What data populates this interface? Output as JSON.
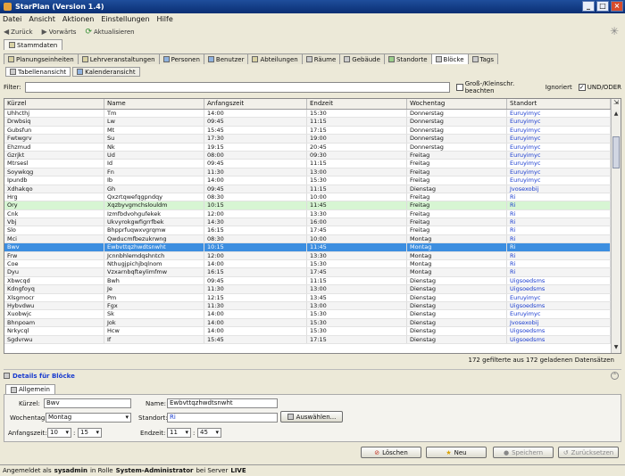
{
  "window": {
    "title": "StarPlan (Version 1.4)"
  },
  "menu": [
    "Datei",
    "Ansicht",
    "Aktionen",
    "Einstellungen",
    "Hilfe"
  ],
  "nav": {
    "back": "Zurück",
    "forward": "Vorwärts",
    "refresh": "Aktualisieren"
  },
  "outer_tab": "Stammdaten",
  "tabs": [
    "Planungseinheiten",
    "Lehrveranstaltungen",
    "Personen",
    "Benutzer",
    "Abteilungen",
    "Räume",
    "Gebäude",
    "Standorte",
    "Blöcke",
    "Tags"
  ],
  "active_tab": "Blöcke",
  "views": [
    "Tabellenansicht",
    "Kalenderansicht"
  ],
  "filter": {
    "label": "Filter:",
    "value": "",
    "case_label": "Groß-/Kleinschr. beachten",
    "ignore_label": "Ignoriert",
    "andor_label": "UND/ODER"
  },
  "columns": [
    "Kürzel",
    "Name",
    "Anfangszeit",
    "Endzeit",
    "Wochentag",
    "Standort"
  ],
  "rows": [
    [
      "Uhhcthj",
      "Tm",
      "14:00",
      "15:30",
      "Donnerstag",
      "Euruyimyc"
    ],
    [
      "Drwbsiq",
      "Lw",
      "09:45",
      "11:15",
      "Donnerstag",
      "Euruyimyc"
    ],
    [
      "Gubsfun",
      "Mt",
      "15:45",
      "17:15",
      "Donnerstag",
      "Euruyimyc"
    ],
    [
      "Fwtwgrv",
      "Su",
      "17:30",
      "19:00",
      "Donnerstag",
      "Euruyimyc"
    ],
    [
      "Ehzmud",
      "Nk",
      "19:15",
      "20:45",
      "Donnerstag",
      "Euruyimyc"
    ],
    [
      "Gzrjkt",
      "Ud",
      "08:00",
      "09:30",
      "Freitag",
      "Euruyimyc"
    ],
    [
      "Mtrsesl",
      "Id",
      "09:45",
      "11:15",
      "Freitag",
      "Euruyimyc"
    ],
    [
      "Soywkqg",
      "Fn",
      "11:30",
      "13:00",
      "Freitag",
      "Euruyimyc"
    ],
    [
      "Ipundb",
      "Ib",
      "14:00",
      "15:30",
      "Freitag",
      "Euruyimyc"
    ],
    [
      "Xdhakqo",
      "Gh",
      "09:45",
      "11:15",
      "Dienstag",
      "Jvosexobij"
    ],
    [
      "Hrg",
      "Qxzrtqwefqgpndqy",
      "08:30",
      "10:00",
      "Freitag",
      "Ri"
    ],
    [
      "Ory",
      "Xqzbyvgmchslouldm",
      "10:15",
      "11:45",
      "Freitag",
      "Ri"
    ],
    [
      "Cnk",
      "Izmfbdvohgufekek",
      "12:00",
      "13:30",
      "Freitag",
      "Ri"
    ],
    [
      "Vbj",
      "Ukvyrokgwfigrrfbek",
      "14:30",
      "16:00",
      "Freitag",
      "Ri"
    ],
    [
      "Slo",
      "Bhpprfuqwxvgrqmw",
      "16:15",
      "17:45",
      "Freitag",
      "Ri"
    ],
    [
      "Mci",
      "Qwducmfbezukrwng",
      "08:30",
      "10:00",
      "Montag",
      "Ri"
    ],
    [
      "Bwv",
      "Ewbvttqzhwdtsnwht",
      "10:15",
      "11:45",
      "Montag",
      "Ri"
    ],
    [
      "Frw",
      "Jcnnbhlemdqshntch",
      "12:00",
      "13:30",
      "Montag",
      "Ri"
    ],
    [
      "Coe",
      "Nthugjpichjbqlnom",
      "14:00",
      "15:30",
      "Montag",
      "Ri"
    ],
    [
      "Dyu",
      "Vzxarnbqfteylimfmw",
      "16:15",
      "17:45",
      "Montag",
      "Ri"
    ],
    [
      "Xbwcqd",
      "Bwh",
      "09:45",
      "11:15",
      "Dienstag",
      "Uigsoedsms"
    ],
    [
      "Kdngfoyq",
      "Je",
      "11:30",
      "13:00",
      "Dienstag",
      "Uigsoedsms"
    ],
    [
      "Xlsgmocr",
      "Pm",
      "12:15",
      "13:45",
      "Dienstag",
      "Euruyimyc"
    ],
    [
      "Hybvdwu",
      "Fgx",
      "11:30",
      "13:00",
      "Dienstag",
      "Uigsoedsms"
    ],
    [
      "Xuobwjc",
      "Sk",
      "14:00",
      "15:30",
      "Dienstag",
      "Euruyimyc"
    ],
    [
      "Bhnpoam",
      "Jok",
      "14:00",
      "15:30",
      "Dienstag",
      "Jvosexobij"
    ],
    [
      "Nrkycql",
      "Hcw",
      "14:00",
      "15:30",
      "Dienstag",
      "Uigsoedsms"
    ],
    [
      "Sgdvrwu",
      "If",
      "15:45",
      "17:15",
      "Dienstag",
      "Uigsoedsms"
    ]
  ],
  "green_row": 11,
  "selected_row": 16,
  "count_text": "172 gefilterte aus 172 geladenen Datensätzen",
  "details": {
    "header": "Details für Blöcke",
    "tab": "Allgemein",
    "kurzel_label": "Kürzel:",
    "kurzel": "Bwv",
    "name_label": "Name:",
    "name": "Ewbvttqzhwdtsnwht",
    "wochentag_label": "Wochentag:",
    "wochentag": "Montag",
    "standort_label": "Standort:",
    "standort": "Ri",
    "choose_button": "Auswählen...",
    "start_label": "Anfangszeit:",
    "start_h": "10",
    "start_m": "15",
    "end_label": "Endzeit:",
    "end_h": "11",
    "end_m": "45"
  },
  "buttons": {
    "delete": "Löschen",
    "new": "Neu",
    "save": "Speichern",
    "reset": "Zurücksetzen"
  },
  "status": {
    "prefix": "Angemeldet als",
    "user": "sysadmin",
    "mid1": "in Rolle",
    "role": "System-Administrator",
    "mid2": "bei Server",
    "server": "LIVE"
  }
}
